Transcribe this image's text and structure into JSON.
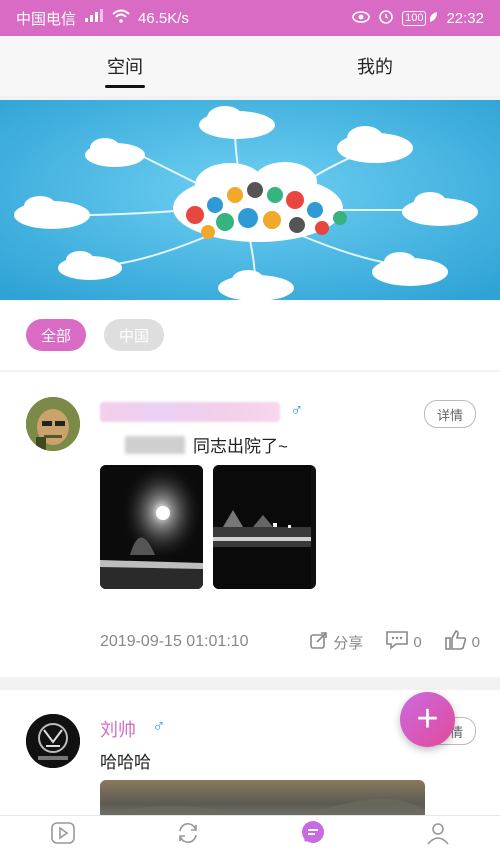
{
  "statusbar": {
    "carrier": "中国电信",
    "network": "46.5K/s",
    "battery": "100",
    "time": "22:32"
  },
  "tabs": [
    {
      "label": "空间"
    },
    {
      "label": "我的"
    }
  ],
  "filters": [
    {
      "label": "全部"
    },
    {
      "label": "中国"
    }
  ],
  "posts": [
    {
      "gender": "♂",
      "detail_label": "详情",
      "content_suffix": "同志出院了~",
      "timestamp": "2019-09-15 01:01:10",
      "share_label": "分享",
      "comment_count": "0",
      "like_count": "0"
    },
    {
      "author": "刘帅",
      "gender": "♂",
      "detail_label": "详情",
      "content": "哈哈哈"
    }
  ],
  "fab_label": "+",
  "icons": [
    "play-icon",
    "refresh-icon",
    "chat-icon",
    "person-icon"
  ],
  "colors": {
    "accent": "#d96bc4",
    "banner": "#47b7e3",
    "gender": "#3a9ee8"
  }
}
